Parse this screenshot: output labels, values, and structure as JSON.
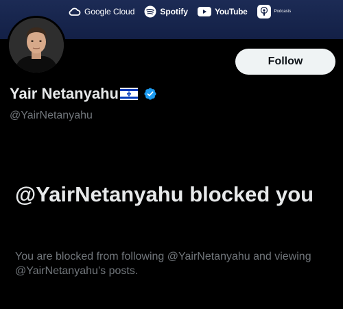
{
  "banner": {
    "sponsors": [
      {
        "name": "Google Cloud",
        "icon": "google-cloud-icon"
      },
      {
        "name": "Spotify",
        "icon": "spotify-icon"
      },
      {
        "name": "YouTube",
        "icon": "youtube-icon"
      },
      {
        "name": "Podcasts",
        "icon": "podcasts-icon"
      }
    ]
  },
  "profile": {
    "display_name": "Yair Netanyahu",
    "handle": "@YairNetanyahu",
    "verified": true,
    "flag_icon": "israel-flag-icon"
  },
  "actions": {
    "follow_label": "Follow"
  },
  "blocked": {
    "title": "@YairNetanyahu blocked you",
    "description": "You are blocked from following @YairNetanyahu and viewing @YairNetanyahu’s posts."
  },
  "colors": {
    "background": "#000000",
    "banner": "#1c2b55",
    "verified_blue": "#1d9bf0",
    "secondary_text": "#71767b",
    "button_bg": "#eff3f4"
  }
}
